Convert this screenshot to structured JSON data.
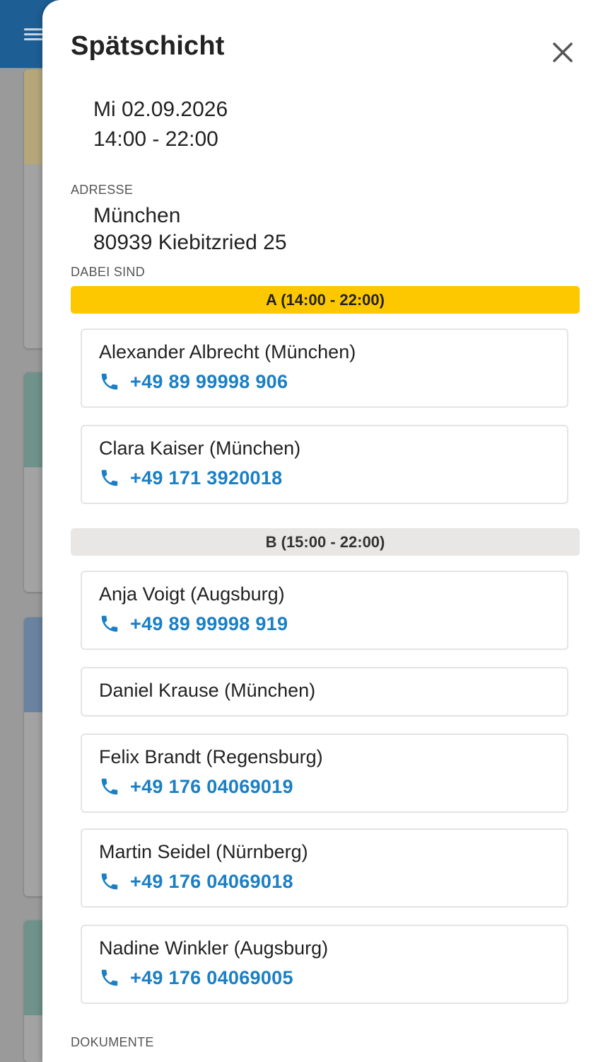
{
  "dialog": {
    "title": "Spätschicht",
    "date_line": "Mi 02.09.2026",
    "time_line": "14:00 - 22:00",
    "address_label": "ADRESSE",
    "address_city": "München",
    "address_street": "80939 Kiebitzried 25",
    "participants_label": "DABEI SIND",
    "documents_label": "DOKUMENTE"
  },
  "groups": [
    {
      "label": "A (14:00 - 22:00)",
      "color": "#fdc800",
      "people": [
        {
          "name": "Alexander Albrecht (München)",
          "phone": "+49 89 99998 906"
        },
        {
          "name": "Clara Kaiser (München)",
          "phone": "+49 171 3920018"
        }
      ]
    },
    {
      "label": "B (15:00 - 22:00)",
      "color": "#e8e7e5",
      "people": [
        {
          "name": "Anja Voigt (Augsburg)",
          "phone": "+49 89 99998 919"
        },
        {
          "name": "Daniel Krause (München)",
          "phone": ""
        },
        {
          "name": "Felix Brandt (Regensburg)",
          "phone": "+49 176 04069019"
        },
        {
          "name": "Martin Seidel (Nürnberg)",
          "phone": "+49 176 04069018"
        },
        {
          "name": "Nadine Winkler (Augsburg)",
          "phone": "+49 176 04069005"
        }
      ]
    }
  ],
  "icons": {
    "close": "close-icon",
    "phone": "phone-icon",
    "menu": "hamburger-menu-icon"
  },
  "colors": {
    "accent_link": "#1a7fc4",
    "header": "#1d5f94"
  }
}
